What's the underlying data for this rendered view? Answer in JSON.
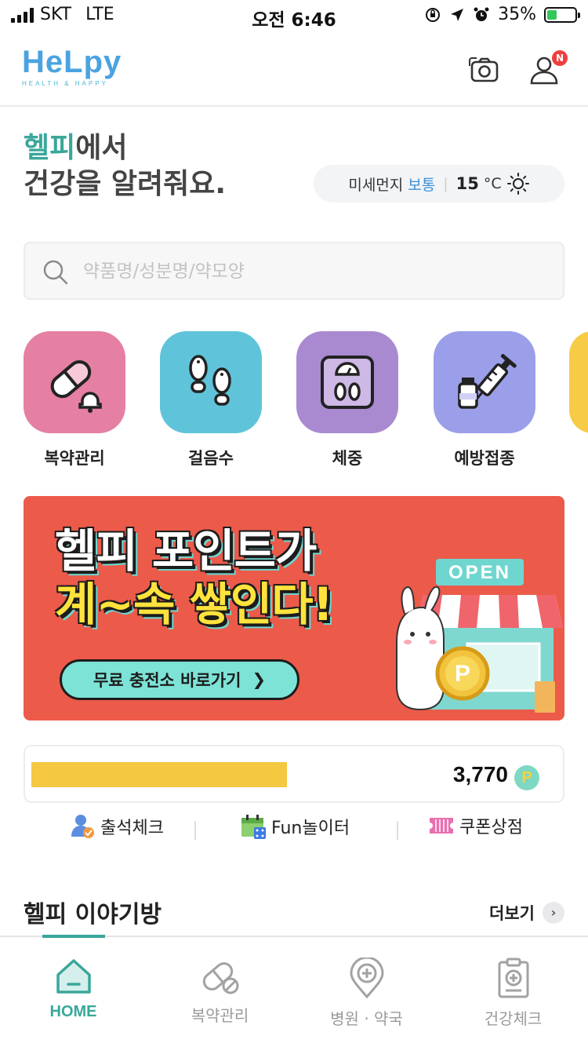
{
  "status_bar": {
    "carrier": "SKT",
    "network": "LTE",
    "time": "오전 6:46",
    "battery": "35%",
    "battery_level": 0.35
  },
  "header": {
    "logo_text": "HeLpy",
    "logo_tagline": "HEALTH & HAPPY",
    "camera_icon": "camera-icon",
    "profile_icon": "profile-icon",
    "notification_badge": "N"
  },
  "greeting": {
    "accent": "헬피",
    "line1_rest": "에서",
    "line2": "건강을 알려줘요."
  },
  "weather": {
    "dust_label": "미세먼지",
    "dust_status": "보통",
    "temperature": "15",
    "temp_unit": "°C",
    "icon": "sun-icon"
  },
  "search": {
    "placeholder": "약품명/성분명/약모양"
  },
  "menu": [
    {
      "label": "복약관리",
      "icon": "pill-alarm-icon",
      "color": "#e57fa3"
    },
    {
      "label": "걸음수",
      "icon": "footsteps-icon",
      "color": "#5fc4d9"
    },
    {
      "label": "체중",
      "icon": "scale-icon",
      "color": "#a98ad0"
    },
    {
      "label": "예방접종",
      "icon": "syringe-icon",
      "color": "#9b9fe9"
    }
  ],
  "banner": {
    "line1": "헬피 포인트가",
    "line2": "계~속 쌓인다!",
    "button_label": "무료 충전소 바로가기",
    "button_arrow": "❯",
    "store_sign": "OPEN",
    "coin_letter": "P"
  },
  "points": {
    "value": "3,770",
    "coin_letter": "P"
  },
  "quick_links": [
    {
      "label": "출석체크",
      "icon": "attendance-icon"
    },
    {
      "label": "Fun놀이터",
      "icon": "calendar-game-icon"
    },
    {
      "label": "쿠폰상점",
      "icon": "coupon-icon"
    }
  ],
  "story": {
    "title": "헬피 이야기방",
    "more_label": "더보기",
    "more_arrow": "›"
  },
  "bottom_nav": [
    {
      "label": "HOME",
      "icon": "home-icon",
      "active": true
    },
    {
      "label": "복약관리",
      "icon": "pill-icon",
      "active": false
    },
    {
      "label": "병원 · 약국",
      "icon": "hospital-pin-icon",
      "active": false
    },
    {
      "label": "건강체크",
      "icon": "clipboard-health-icon",
      "active": false
    }
  ],
  "colors": {
    "brand": "#3aa79a",
    "banner_bg": "#ec5a4a",
    "points_highlight": "#f5c842"
  }
}
